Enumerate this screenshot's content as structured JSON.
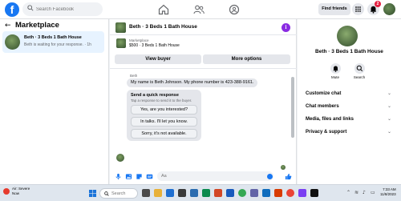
{
  "colors": {
    "accent": "#1877f2",
    "page_bg": "#f0f2f5",
    "info_purple": "#8a2be2",
    "badge_red": "#e41e3f"
  },
  "topnav": {
    "logo_letter": "f",
    "search_placeholder": "Search Facebook",
    "nav_icons": [
      "home-icon",
      "friends-icon",
      "groups-icon"
    ],
    "find_friends_label": "Find friends",
    "notification_count": "2",
    "right_icons": [
      "menu-grid-icon",
      "messenger-icon",
      "bell-icon",
      "account-avatar"
    ]
  },
  "left_panel": {
    "back_icon": "←",
    "title": "Marketplace",
    "conversation": {
      "name": "Beth · 3 Beds 1 Bath House",
      "preview": "Beth is waiting for your response. · 1h"
    }
  },
  "chat": {
    "header_title": "Beth · 3 Beds 1 Bath House",
    "info_icon": "i",
    "listing": {
      "label": "Marketplace",
      "details": "$500 · 3 Beds 1 Bath House"
    },
    "view_buyer_label": "View buyer",
    "more_options_label": "More options",
    "sender_name": "Beth",
    "message": "My name is Beth Johnson. My phone number is 423-388-9161.",
    "quick_response": {
      "title": "Send a quick response",
      "subtitle": "Tap a response to send it to the buyer.",
      "options": [
        "Yes, are you interested?",
        "In talks. I'll let you know.",
        "Sorry, it's not available."
      ]
    },
    "waiting_text": "Beth is waiting for your response.",
    "composer_placeholder": "Aa",
    "composer_icons": [
      "mic-icon",
      "photo-icon",
      "sticker-icon",
      "gif-icon"
    ]
  },
  "right_panel": {
    "name": "Beth · 3 Beds 1 Bath House",
    "actions": [
      {
        "label": "Mute"
      },
      {
        "label": "Search"
      }
    ],
    "rows": [
      "Customize chat",
      "Chat members",
      "Media, files and links",
      "Privacy & support"
    ]
  },
  "taskbar": {
    "weather_title": "Air: Severe",
    "weather_sub": "Now",
    "search_placeholder": "Search",
    "time": "7:33 AM",
    "date": "11/8/2023"
  }
}
